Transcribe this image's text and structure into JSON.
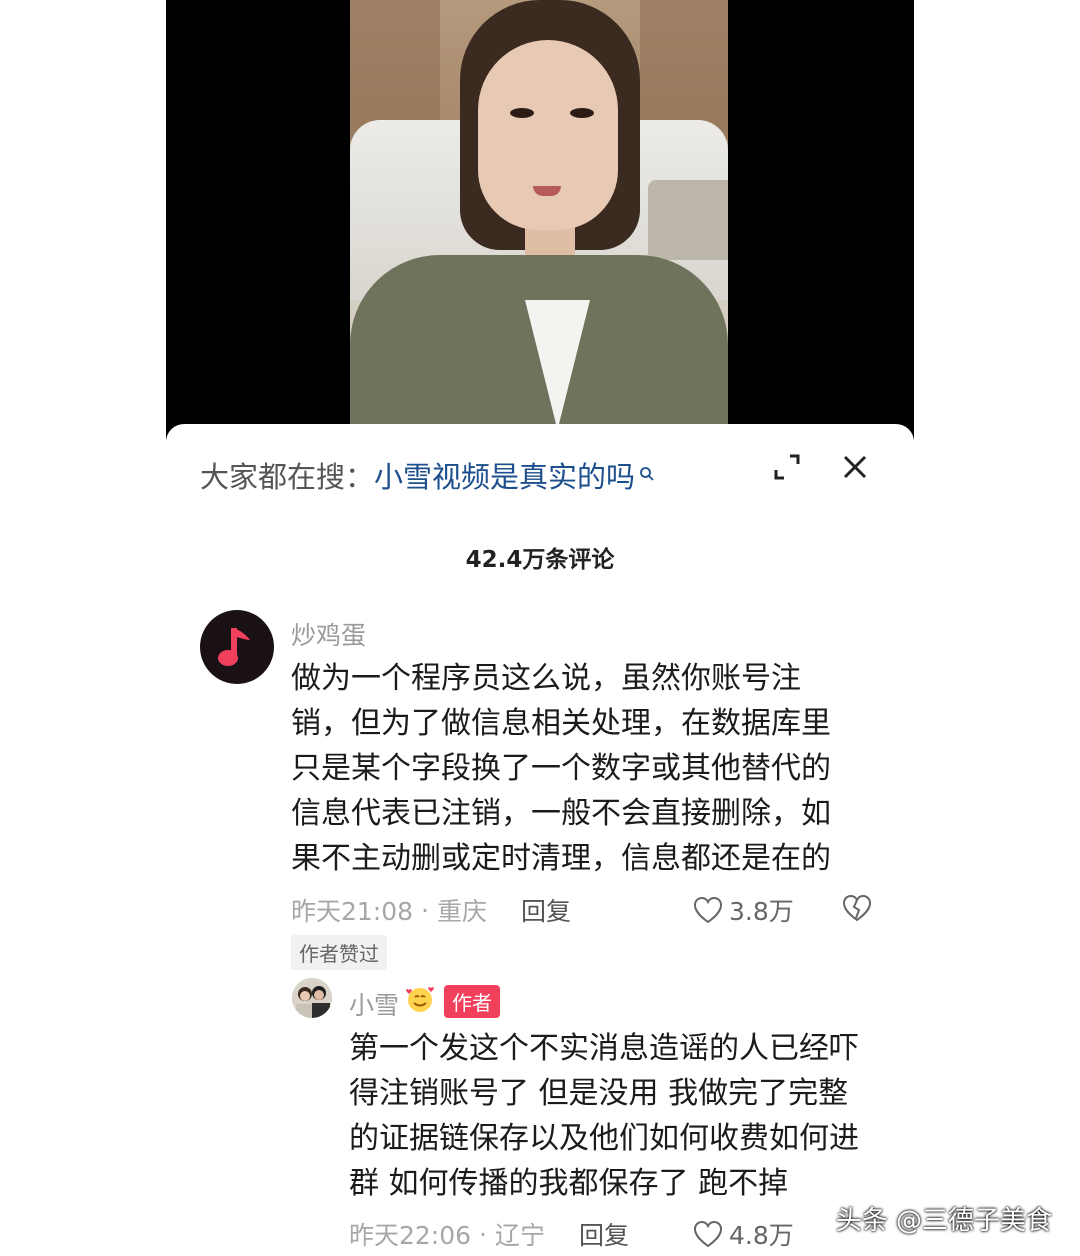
{
  "search": {
    "label": "大家都在搜：",
    "term": "小雪视频是真实的吗"
  },
  "comments_header": {
    "count_label": "42.4万条评论"
  },
  "comment": {
    "username": "炒鸡蛋",
    "lines": [
      "做为一个程序员这么说，虽然你账号注",
      "销，但为了做信息相关处理，在数据库里",
      "只是某个字段换了一个数字或其他替代的",
      "信息代表已注销，一般不会直接删除，如",
      "果不主动删或定时清理，信息都还是在的"
    ],
    "time": "昨天21:08",
    "separator": "·",
    "location": "重庆",
    "reply_label": "回复",
    "like_count": "3.8万",
    "author_liked_badge": "作者赞过"
  },
  "reply": {
    "username": "小雪",
    "author_tag": "作者",
    "lines": [
      "第一个发这个不实消息造谣的人已经吓",
      "得注销账号了 但是没用 我做完了完整",
      "的证据链保存以及他们如何收费如何进",
      "群 如何传播的我都保存了 跑不掉"
    ],
    "time": "昨天22:06",
    "separator": "·",
    "location": "辽宁",
    "reply_label": "回复",
    "like_count": "4.8万"
  },
  "watermark": "头条 @三德子美食",
  "colors": {
    "search_term": "#1d4f8c",
    "author_tag": "#f0405c",
    "avatar_note": "#f0405c"
  }
}
